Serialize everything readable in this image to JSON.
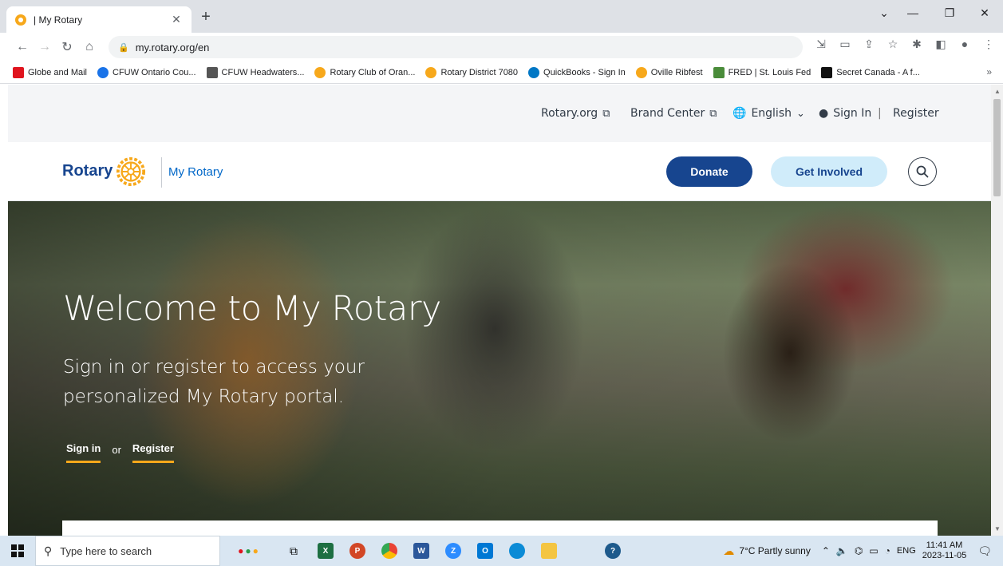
{
  "browser": {
    "tab_title": "| My Rotary",
    "url": "my.rotary.org/en",
    "bookmarks": [
      {
        "label": "Globe and Mail",
        "color": "#e0141e"
      },
      {
        "label": "CFUW Ontario Cou...",
        "color": "#1a73e8"
      },
      {
        "label": "CFUW Headwaters...",
        "color": "#555555"
      },
      {
        "label": "Rotary Club of Oran...",
        "color": "#f7a81b"
      },
      {
        "label": "Rotary District 7080",
        "color": "#f7a81b"
      },
      {
        "label": "QuickBooks - Sign In",
        "color": "#0077c5"
      },
      {
        "label": "Oville Ribfest",
        "color": "#f7a81b"
      },
      {
        "label": "FRED | St. Louis Fed",
        "color": "#4a8c3a"
      },
      {
        "label": "Secret Canada - A f...",
        "color": "#111111"
      }
    ],
    "bookmarks_more": "»"
  },
  "utility": {
    "rotary_org": "Rotary.org",
    "brand_center": "Brand Center",
    "language": "English",
    "sign_in": "Sign In",
    "separator": "|",
    "register": "Register"
  },
  "header": {
    "logo": "Rotary",
    "section": "My Rotary",
    "donate": "Donate",
    "get_involved": "Get Involved"
  },
  "hero": {
    "title": "Welcome to My Rotary",
    "subtitle": "Sign in or register to access your personalized My Rotary portal.",
    "sign_in": "Sign in",
    "or": "or",
    "register": "Register"
  },
  "taskbar": {
    "search_placeholder": "Type here to search",
    "weather": "7°C  Partly sunny",
    "lang": "ENG",
    "time": "11:41 AM",
    "date": "2023-11-05"
  },
  "colors": {
    "rotary_blue": "#17458f",
    "rotary_gold": "#f7a81b",
    "azure_light": "#d0ecfa"
  }
}
